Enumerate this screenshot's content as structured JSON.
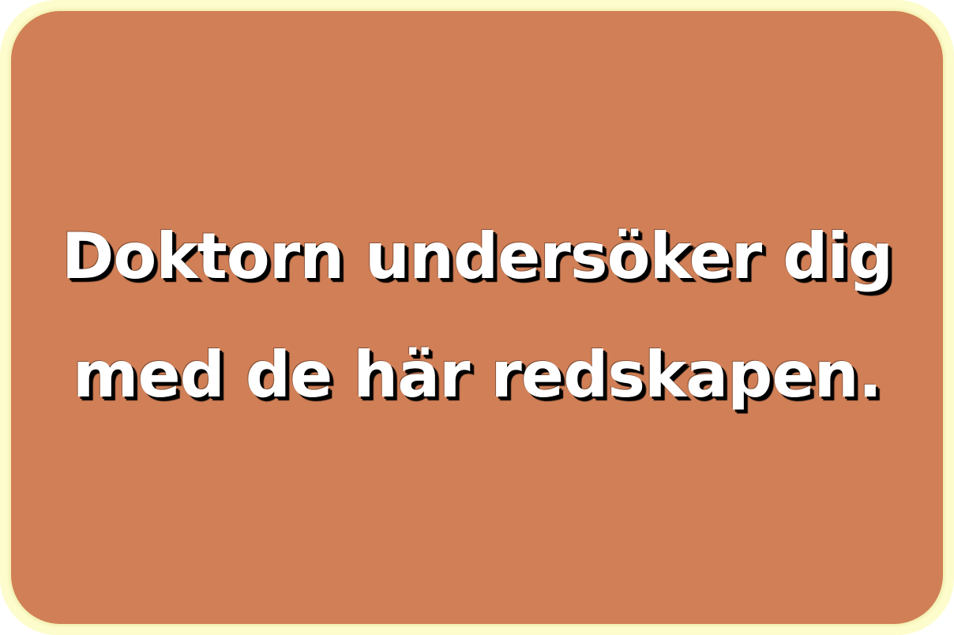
{
  "card": {
    "background_color": "#d17f56",
    "border_color": "#fdfccc",
    "lines": [
      "Doktorn undersöker dig",
      "med de här redskapen."
    ]
  }
}
